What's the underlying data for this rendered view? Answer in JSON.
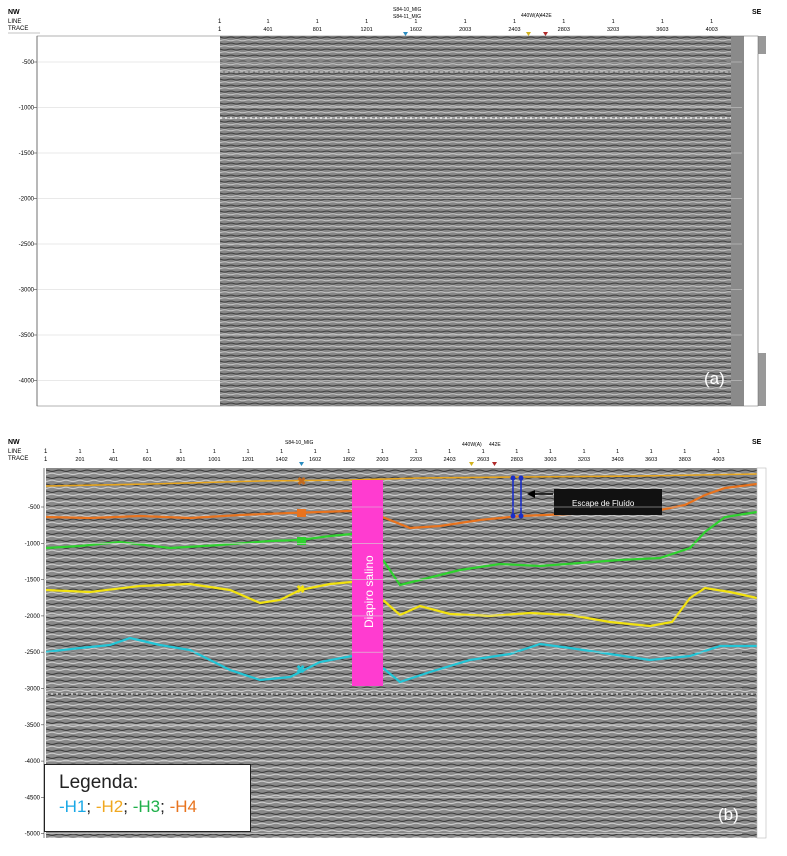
{
  "panel_a": {
    "label": "(a)",
    "dir_left": "NW",
    "dir_right": "SE",
    "header_line": "LINE",
    "header_trace": "TRACE",
    "trace_ticks": [
      "401",
      "801",
      "1201",
      "1602",
      "2003",
      "2403",
      "2803",
      "3203",
      "3603",
      "4003"
    ],
    "line_ticks": [
      "1",
      "1",
      "1",
      "1",
      "1",
      "1",
      "1",
      "1",
      "1",
      "1"
    ],
    "start_line": "1",
    "start_trace": "1",
    "well_a": "S84-10_MIG",
    "well_b": "S84-11_MIG",
    "well_c": "440W(A)",
    "well_d": "442E",
    "depth_ticks": [
      "-500",
      "-1000",
      "-1500",
      "-2000",
      "-2500",
      "-3000",
      "-3500",
      "-4000"
    ]
  },
  "panel_b": {
    "label": "(b)",
    "dir_left": "NW",
    "dir_right": "SE",
    "header_line": "LINE",
    "header_trace": "TRACE",
    "start_line": "1",
    "start_trace": "1",
    "trace_ticks": [
      "201",
      "401",
      "601",
      "801",
      "1001",
      "1201",
      "1402",
      "1602",
      "1802",
      "2003",
      "2203",
      "2403",
      "2603",
      "2803",
      "3003",
      "3203",
      "3403",
      "3603",
      "3803",
      "4003"
    ],
    "line_ticks": [
      "1",
      "1",
      "1",
      "1",
      "1",
      "1",
      "1",
      "1",
      "1",
      "1",
      "1",
      "1",
      "1",
      "1",
      "1",
      "1",
      "1",
      "1",
      "1",
      "1"
    ],
    "well_a": "S84-10_MIG",
    "well_c": "440W(A)",
    "well_d": "442E",
    "depth_ticks": [
      "-500",
      "-1000",
      "-1500",
      "-2000",
      "-2500",
      "-3000",
      "-3500",
      "-4000",
      "-4500",
      "-5000"
    ],
    "diapir_label": "Diapiro salino",
    "fluid_label": "Escape de Fluído"
  },
  "legend": {
    "title": "Legenda:",
    "h1": "-H1",
    "sep1": "; ",
    "h2": "-H2",
    "sep2": "; ",
    "h3": "-H3",
    "sep3": "; ",
    "h4": "-H4"
  },
  "colors": {
    "h1": "#22c5d6",
    "h2": "#f2e20f",
    "h3": "#2fd12f",
    "h4": "#e8731e",
    "seafloor": "#e8a61e",
    "diapir": "#ff3cd0",
    "fluid_marker": "#1a2ec8",
    "legend_h1": "#1aa8e6",
    "legend_h2": "#f0a820",
    "legend_h3": "#1fb04a",
    "legend_h4": "#e8731e"
  }
}
